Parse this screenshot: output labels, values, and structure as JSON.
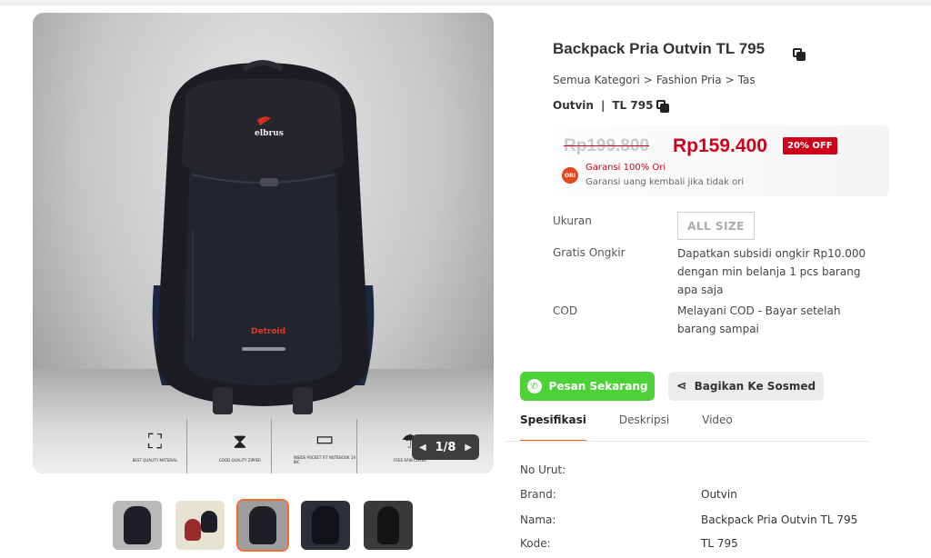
{
  "product": {
    "title": "Backpack Pria Outvin TL 795",
    "breadcrumb": [
      "Semua Kategori",
      ">",
      "Fashion Pria",
      ">",
      "Tas"
    ],
    "brand": "Outvin",
    "separator": "|",
    "code": "TL 795"
  },
  "gallery": {
    "bag_logo": "elbrus",
    "bag_model": "Detroid",
    "features": [
      {
        "icon": "chair-icon",
        "caption": "best quality material"
      },
      {
        "icon": "zipper-icon",
        "caption": "good quality zipper"
      },
      {
        "icon": "laptop-icon",
        "caption": "inside pocket fit notebook 14 inc"
      },
      {
        "icon": "rain-cover-icon",
        "caption": "free rain cover"
      }
    ],
    "pager": {
      "current": "1/8",
      "prev_icon": "chevron-left-icon",
      "next_icon": "chevron-right-icon"
    },
    "thumbnails": [
      {
        "bg": "#b9b9b9",
        "active": false
      },
      {
        "bg": "#e7e3d2",
        "active": false
      },
      {
        "bg": "#9d9d9d",
        "active": true
      },
      {
        "bg": "#2b2f38",
        "active": false
      },
      {
        "bg": "#3a3a3a",
        "active": false
      }
    ]
  },
  "price": {
    "original": "Rp199.800",
    "discounted": "Rp159.400",
    "discount_badge": "20% OFF",
    "ori_badge": "ORI",
    "guarantee_title": "Garansi 100% Ori",
    "guarantee_sub": "Garansi uang kembali jika tidak ori"
  },
  "info": {
    "size_label": "Ukuran",
    "size_value": "ALL SIZE",
    "shipping_label": "Gratis Ongkir",
    "shipping_value": "Dapatkan subsidi ongkir Rp10.000 dengan min belanja 1 pcs barang apa saja",
    "cod_label": "COD",
    "cod_value": "Melayani COD - Bayar setelah barang sampai"
  },
  "actions": {
    "order_label": "Pesan Sekarang",
    "share_label": "Bagikan Ke Sosmed"
  },
  "tabs": [
    "Spesifikasi",
    "Deskripsi",
    "Video"
  ],
  "specs": [
    {
      "label": "No Urut:",
      "value": ""
    },
    {
      "label": "Brand:",
      "value": "Outvin"
    },
    {
      "label": "Nama:",
      "value": "Backpack Pria Outvin TL 795"
    },
    {
      "label": "Kode:",
      "value": "TL 795"
    }
  ],
  "colors": {
    "accent": "#f26b2d",
    "price_red": "#d0021b",
    "whatsapp_green": "#4cd137"
  }
}
